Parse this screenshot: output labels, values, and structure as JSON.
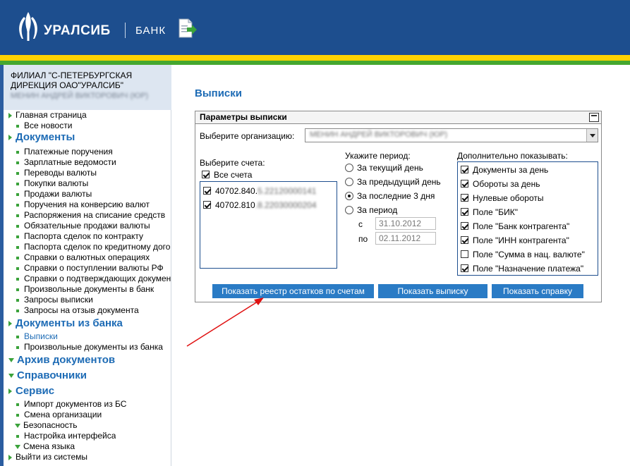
{
  "header": {
    "logo_text": "УРАЛСИБ",
    "bank_text": "БАНК",
    "colors": {
      "header_bg": "#1d4e8e",
      "stripe_yellow": "#ffd200",
      "stripe_green": "#45a72f"
    }
  },
  "sidebar": {
    "branch_line1": "ФИЛИАЛ \"С-ПЕТЕРБУРГСКАЯ",
    "branch_line2": "ДИРЕКЦИЯ ОАО\"УРАЛСИБ\"",
    "branch_user": "МЕНИН АНДРЕЙ ВИКТОРОВИЧ (ЮР)",
    "items": {
      "home": "Главная страница",
      "all_news": "Все новости",
      "documents": "Документы",
      "payment_orders": "Платежные поручения",
      "salary_sheets": "Зарплатные ведомости",
      "fx_transfers": "Переводы валюты",
      "fx_purchases": "Покупки валюты",
      "fx_sales": "Продажи валюты",
      "fx_conversion": "Поручения на конверсию валют",
      "debit_orders": "Распоряжения на списание средств",
      "mandatory_sales": "Обязательные продажи валюты",
      "deal_passports_contract": "Паспорта сделок по контракту",
      "deal_passports_credit": "Паспорта сделок по кредитному дого",
      "fx_operation_certs": "Справки о валютных операциях",
      "fx_receipt_certs": "Справки о поступлении валюты РФ",
      "supporting_docs_certs": "Справки о подтверждающих докумен",
      "arbitrary_docs": "Произвольные документы в банк",
      "statement_requests": "Запросы выписки",
      "recall_requests": "Запросы на отзыв документа",
      "docs_from_bank": "Документы из банка",
      "statements": "Выписки",
      "arbitrary_docs_from_bank": "Произвольные документы из банка",
      "doc_archive": "Архив документов",
      "directories": "Справочники",
      "service": "Сервис",
      "import_docs": "Импорт документов из БС",
      "change_org": "Смена организации",
      "security": "Безопасность",
      "interface_settings": "Настройка интерфейса",
      "change_language": "Смена языка",
      "logout": "Выйти из системы"
    }
  },
  "main": {
    "title": "Выписки",
    "panel_title": "Параметры выписки",
    "org_label": "Выберите организацию:",
    "org_value": "МЕНИН АНДРЕЙ ВИКТОРОВИЧ (ЮР)",
    "accounts_label": "Выберите счета:",
    "all_accounts_label": "Все счета",
    "accounts": [
      {
        "visible": "40702.840.",
        "hidden": "5.22120000141"
      },
      {
        "visible": "40702.810",
        "hidden": ".8.22030000204"
      }
    ],
    "period_label": "Укажите период:",
    "period_options": [
      "За текущий день",
      "За предыдущий день",
      "За последние 3 дня",
      "За период"
    ],
    "selected_period": "За последние 3 дня",
    "from_label": "с",
    "to_label": "по",
    "date_from": "31.10.2012",
    "date_to": "02.11.2012",
    "extra_label": "Дополнительно показывать:",
    "extra_options": [
      {
        "label": "Документы за день",
        "checked": true
      },
      {
        "label": "Обороты за день",
        "checked": true
      },
      {
        "label": "Нулевые обороты",
        "checked": true
      },
      {
        "label": "Поле \"БИК\"",
        "checked": true
      },
      {
        "label": "Поле \"Банк контрагента\"",
        "checked": true
      },
      {
        "label": "Поле \"ИНН контрагента\"",
        "checked": true
      },
      {
        "label": "Поле \"Сумма в нац. валюте\"",
        "checked": false
      },
      {
        "label": "Поле \"Назначение платежа\"",
        "checked": true
      }
    ],
    "buttons": {
      "show_balances": "Показать реестр остатков по счетам",
      "show_statement": "Показать выписку",
      "show_certificate": "Показать справку"
    },
    "colors": {
      "accent": "#1d6bb5",
      "button": "#2a7bc5",
      "arrow": "#e01010"
    }
  }
}
